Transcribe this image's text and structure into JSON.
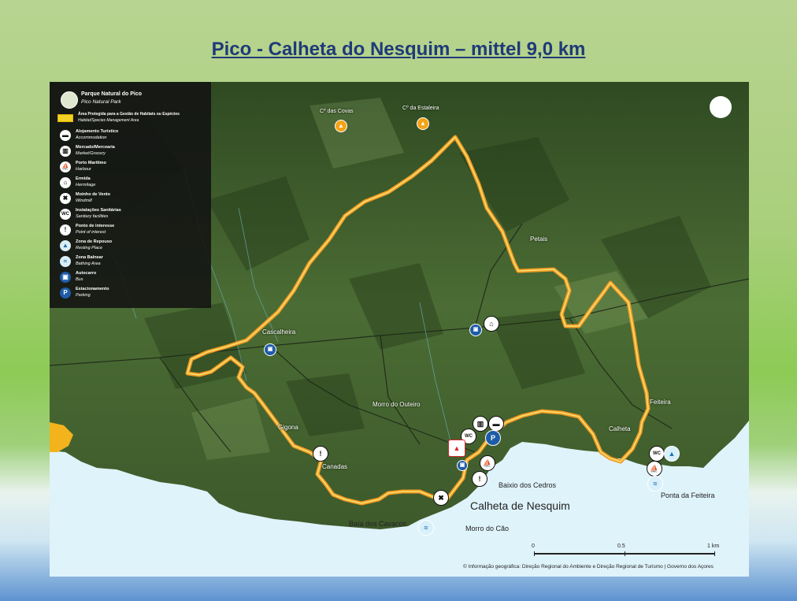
{
  "title": "Pico - Calheta do Nesquim – mittel 9,0 km",
  "legend": {
    "park_name": "Parque Natural do Pico",
    "park_name_en": "Pico Natural Park",
    "area_label": "Área Protegida para a Gestão de Habitats ou Espécies",
    "area_label_en": "Habitat/Species Management Area",
    "items": [
      {
        "label": "Alojamento Turístico",
        "label_en": "Accommodation",
        "icon": "bed-icon"
      },
      {
        "label": "Mercado/Mercearia",
        "label_en": "Market/Grocery",
        "icon": "cart-icon"
      },
      {
        "label": "Porto Marítimo",
        "label_en": "Harbour",
        "icon": "boat-icon"
      },
      {
        "label": "Ermida",
        "label_en": "Hermitage",
        "icon": "chapel-icon"
      },
      {
        "label": "Moinho de Vento",
        "label_en": "Windmill",
        "icon": "windmill-icon"
      },
      {
        "label": "Instalações Sanitárias",
        "label_en": "Sanitary facilities",
        "icon": "wc-icon"
      },
      {
        "label": "Ponto de interesse",
        "label_en": "Point of interest",
        "icon": "info-icon"
      },
      {
        "label": "Zona de Repouso",
        "label_en": "Resting Place",
        "icon": "rest-icon"
      },
      {
        "label": "Zona Balnear",
        "label_en": "Bathing Area",
        "icon": "swim-icon"
      },
      {
        "label": "Autocarro",
        "label_en": "Bus",
        "icon": "bus-icon"
      },
      {
        "label": "Estacionamento",
        "label_en": "Parking",
        "icon": "parking-icon"
      }
    ]
  },
  "places": {
    "peak1": "Cº das Covas",
    "peak2": "Cº da Estaleira",
    "petais": "Petais",
    "cascalheira": "Cascalheira",
    "morro_outeiro": "Morro do Outeiro",
    "feiteira": "Feiteira",
    "calheta": "Calheta",
    "gigona": "Gigona",
    "canadas": "Canadas",
    "baixio": "Baixio dos Cedros",
    "calheta_nesquim": "Calheta de Nesquim",
    "baia": "Baía dos Cavacos",
    "morro_cao": "Morro do Cão",
    "ponta": "Ponta da Feiteira"
  },
  "scale": {
    "t0": "0",
    "t1": "0.5",
    "t2": "1 km"
  },
  "credit": "© Informação geográfica: Direção Regional do Ambiente e Direção Regional de Turismo | Governo dos Açores",
  "colors": {
    "trail": "#f29a1f",
    "trail_core": "#f6e27a",
    "sea": "#dff3fb",
    "land": "#3f5f2c",
    "protected_area": "#f2b31c"
  },
  "symbols": {
    "wc": "WC",
    "parking": "P",
    "poi": "!"
  }
}
